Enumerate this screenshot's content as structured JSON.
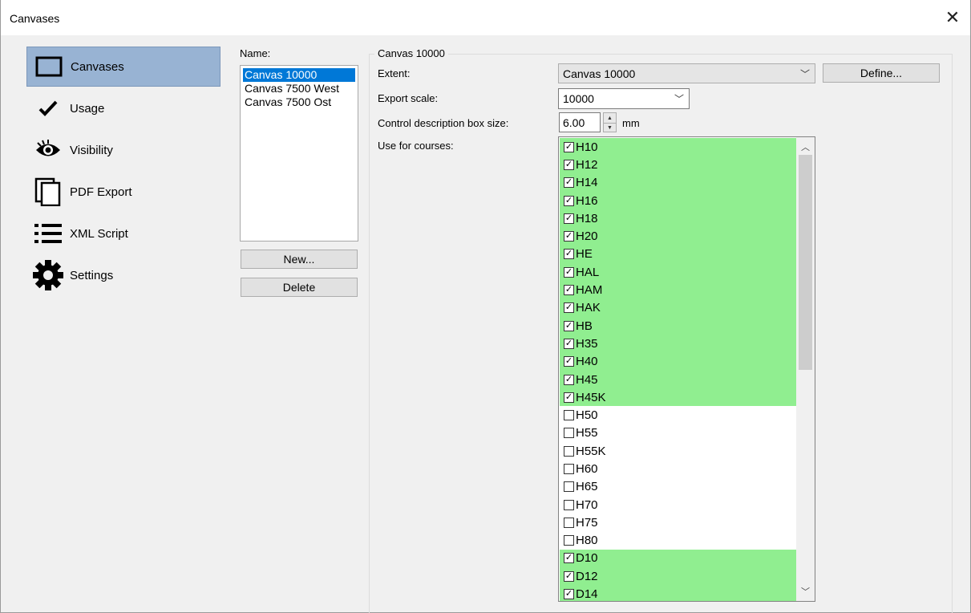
{
  "window": {
    "title": "Canvases"
  },
  "nav": {
    "items": [
      {
        "label": "Canvases",
        "icon": "canvas-rectangle-icon",
        "selected": true
      },
      {
        "label": "Usage",
        "icon": "checkmark-icon"
      },
      {
        "label": "Visibility",
        "icon": "eye-icon"
      },
      {
        "label": "PDF Export",
        "icon": "pages-icon"
      },
      {
        "label": "XML Script",
        "icon": "list-icon"
      },
      {
        "label": "Settings",
        "icon": "gear-icon"
      }
    ]
  },
  "names": {
    "label": "Name:",
    "items": [
      "Canvas 10000",
      "Canvas 7500 West",
      "Canvas 7500 Ost"
    ],
    "selected_index": 0,
    "new_button": "New...",
    "delete_button": "Delete"
  },
  "details": {
    "group_title": "Canvas 10000",
    "extent_label": "Extent:",
    "extent_value": "Canvas 10000",
    "define_button": "Define...",
    "export_scale_label": "Export scale:",
    "export_scale_value": "10000",
    "box_size_label": "Control description box size:",
    "box_size_value": "6.00",
    "box_size_unit": "mm",
    "courses_label": "Use for courses:"
  },
  "courses": [
    {
      "name": "H10",
      "checked": true
    },
    {
      "name": "H12",
      "checked": true
    },
    {
      "name": "H14",
      "checked": true
    },
    {
      "name": "H16",
      "checked": true
    },
    {
      "name": "H18",
      "checked": true
    },
    {
      "name": "H20",
      "checked": true
    },
    {
      "name": "HE",
      "checked": true
    },
    {
      "name": "HAL",
      "checked": true
    },
    {
      "name": "HAM",
      "checked": true
    },
    {
      "name": "HAK",
      "checked": true
    },
    {
      "name": "HB",
      "checked": true
    },
    {
      "name": "H35",
      "checked": true
    },
    {
      "name": "H40",
      "checked": true
    },
    {
      "name": "H45",
      "checked": true
    },
    {
      "name": "H45K",
      "checked": true
    },
    {
      "name": "H50",
      "checked": false
    },
    {
      "name": "H55",
      "checked": false
    },
    {
      "name": "H55K",
      "checked": false
    },
    {
      "name": "H60",
      "checked": false
    },
    {
      "name": "H65",
      "checked": false
    },
    {
      "name": "H70",
      "checked": false
    },
    {
      "name": "H75",
      "checked": false
    },
    {
      "name": "H80",
      "checked": false
    },
    {
      "name": "D10",
      "checked": true
    },
    {
      "name": "D12",
      "checked": true
    },
    {
      "name": "D14",
      "checked": true
    }
  ],
  "colors": {
    "checked_row": "#90ee90",
    "nav_selected": "#98b3d3",
    "list_selected": "#0078d7"
  }
}
